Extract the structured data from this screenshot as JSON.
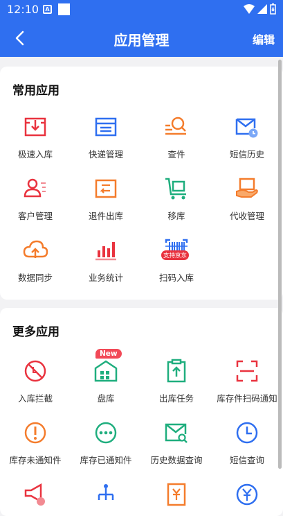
{
  "status_bar": {
    "time": "12:10"
  },
  "header": {
    "title": "应用管理",
    "edit_label": "编辑"
  },
  "common_apps": {
    "title": "常用应用",
    "items": [
      {
        "label": "极速入库",
        "icon": "fast-inbound-icon"
      },
      {
        "label": "快递管理",
        "icon": "express-manage-icon"
      },
      {
        "label": "查件",
        "icon": "search-parcel-icon"
      },
      {
        "label": "短信历史",
        "icon": "sms-history-icon"
      },
      {
        "label": "客户管理",
        "icon": "customer-icon"
      },
      {
        "label": "退件出库",
        "icon": "return-outbound-icon"
      },
      {
        "label": "移库",
        "icon": "move-stock-icon"
      },
      {
        "label": "代收管理",
        "icon": "collect-manage-icon"
      },
      {
        "label": "数据同步",
        "icon": "cloud-sync-icon"
      },
      {
        "label": "业务统计",
        "icon": "bar-chart-icon"
      },
      {
        "label": "扫码入库",
        "icon": "barcode-scan-icon",
        "badge": "支持京东"
      }
    ]
  },
  "more_apps": {
    "title": "更多应用",
    "items": [
      {
        "label": "入库拦截",
        "icon": "block-icon"
      },
      {
        "label": "盘库",
        "icon": "warehouse-icon",
        "badge": "New"
      },
      {
        "label": "出库任务",
        "icon": "clipboard-upload-icon"
      },
      {
        "label": "库存件扫码通知",
        "icon": "scan-frame-icon"
      },
      {
        "label": "库存未通知件",
        "icon": "alert-icon"
      },
      {
        "label": "库存已通知件",
        "icon": "chat-dots-icon"
      },
      {
        "label": "历史数据查询",
        "icon": "mail-search-icon"
      },
      {
        "label": "短信查询",
        "icon": "clock-icon"
      },
      {
        "label": "",
        "icon": "megaphone-icon"
      },
      {
        "label": "",
        "icon": "hierarchy-icon"
      },
      {
        "label": "",
        "icon": "invoice-icon"
      },
      {
        "label": "",
        "icon": "yen-icon"
      }
    ]
  },
  "colors": {
    "brand": "#2f6ff0",
    "red": "#e9333f",
    "orange": "#f47c2c",
    "blue": "#2f6ff0",
    "green": "#1fae7e"
  }
}
